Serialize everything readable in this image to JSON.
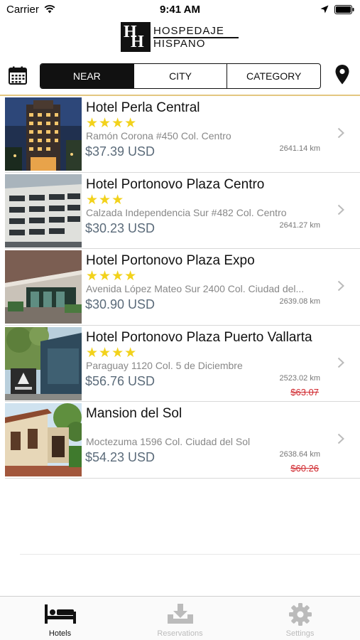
{
  "status_bar": {
    "carrier": "Carrier",
    "time": "9:41 AM"
  },
  "logo": {
    "mark": "HH",
    "line1": "HOSPEDAJE",
    "line2": "HISPANO"
  },
  "toolbar": {
    "calendar_icon": "calendar-icon",
    "location_icon": "map-pin-icon",
    "segments": [
      {
        "label": "NEAR",
        "active": true
      },
      {
        "label": "CITY",
        "active": false
      },
      {
        "label": "CATEGORY",
        "active": false
      }
    ]
  },
  "hotels": [
    {
      "name": "Hotel Perla Central",
      "stars": "★★★★",
      "address": "Ramón Corona #450 Col. Centro",
      "price": "$37.39 USD",
      "distance": "2641.14 km",
      "old_price": ""
    },
    {
      "name": "Hotel Portonovo Plaza Centro",
      "stars": "★★★",
      "address": "Calzada Independencia Sur #482 Col. Centro",
      "price": "$30.23 USD",
      "distance": "2641.27 km",
      "old_price": ""
    },
    {
      "name": "Hotel Portonovo Plaza Expo",
      "stars": "★★★★",
      "address": "Avenida López Mateo Sur 2400 Col. Ciudad del...",
      "price": "$30.90 USD",
      "distance": "2639.08 km",
      "old_price": ""
    },
    {
      "name": "Hotel Portonovo Plaza Puerto Vallarta",
      "stars": "★★★★",
      "address": "Paraguay 1120 Col. 5 de Diciembre",
      "price": "$56.76 USD",
      "distance": "2523.02 km",
      "old_price": "$63.07"
    },
    {
      "name": "Mansion del Sol",
      "stars": "",
      "address": "Moctezuma 1596 Col. Ciudad del Sol",
      "price": "$54.23 USD",
      "distance": "2638.64 km",
      "old_price": "$60.26"
    }
  ],
  "tab_bar": {
    "tabs": [
      {
        "label": "Hotels",
        "icon": "bed-icon",
        "active": true
      },
      {
        "label": "Reservations",
        "icon": "download-tray-icon",
        "active": false
      },
      {
        "label": "Settings",
        "icon": "gear-icon",
        "active": false
      }
    ]
  },
  "colors": {
    "accent_gold": "#e3c780",
    "star_yellow": "#f2d21b",
    "price_slate": "#5b6b7a",
    "discount_red": "#d0282e"
  }
}
